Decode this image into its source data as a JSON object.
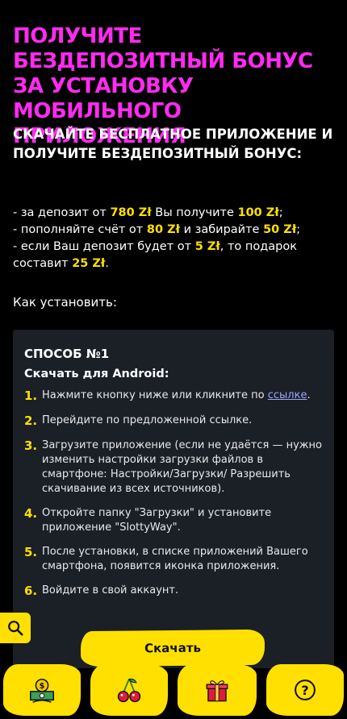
{
  "hero": {
    "title": "ПОЛУЧИТЕ БЕЗДЕПОЗИТНЫЙ БОНУС ЗА УСТАНОВКУ МОБИЛЬНОГО ПРИЛОЖЕНИЯ",
    "subtitle": "СКАЧАЙТЕ БЕСПЛАТНОЕ ПРИЛОЖЕНИЕ И ПОЛУЧИТЕ БЕЗДЕПОЗИТНЫЙ БОНУС:"
  },
  "bonus": {
    "line1": {
      "a": "- за депозит от ",
      "b": "780 Zł",
      "c": " Вы получите ",
      "d": "100 Zł",
      "e": ";"
    },
    "line2": {
      "a": "- пополняйте счёт от ",
      "b": "80 Zł",
      "c": " и забирайте ",
      "d": "50 Zł",
      "e": ";"
    },
    "line3": {
      "a": "- если Ваш депозит будет от ",
      "b": "5 Zł",
      "c": ", то подарок составит ",
      "d": "25 Zł",
      "e": "."
    }
  },
  "how_label": "Как установить:",
  "card": {
    "title": "СПОСОБ №1",
    "subtitle": "Скачать для Android:",
    "steps": [
      {
        "num": "1.",
        "text": "Нажмите кнопку ниже или кликните по ",
        "link": "ссылке",
        "after": "."
      },
      {
        "num": "2.",
        "text": "Перейдите по предложенной ссылке."
      },
      {
        "num": "3.",
        "text": "Загрузите приложение (если не удаётся — нужно изменить настройки загрузки файлов в смартфоне: Настройки/Загрузки/ Разрешить скачивание из всех источников)."
      },
      {
        "num": "4.",
        "text": "Откройте папку \"Загрузки\" и установите приложение \"SlottyWay\"."
      },
      {
        "num": "5.",
        "text": "После установки, в списке приложений Вашего смартфона, появится иконка приложения."
      },
      {
        "num": "6.",
        "text": "Войдите в свой аккаунт."
      }
    ]
  },
  "download_button": "Скачать",
  "colors": {
    "accent_pink": "#ff2bf0",
    "accent_yellow": "#ffe000",
    "card_bg": "#1b1f26"
  },
  "nav_icons": [
    "money-icon",
    "cherries-icon",
    "gift-icon",
    "help-icon"
  ],
  "search_icon": "search-icon"
}
